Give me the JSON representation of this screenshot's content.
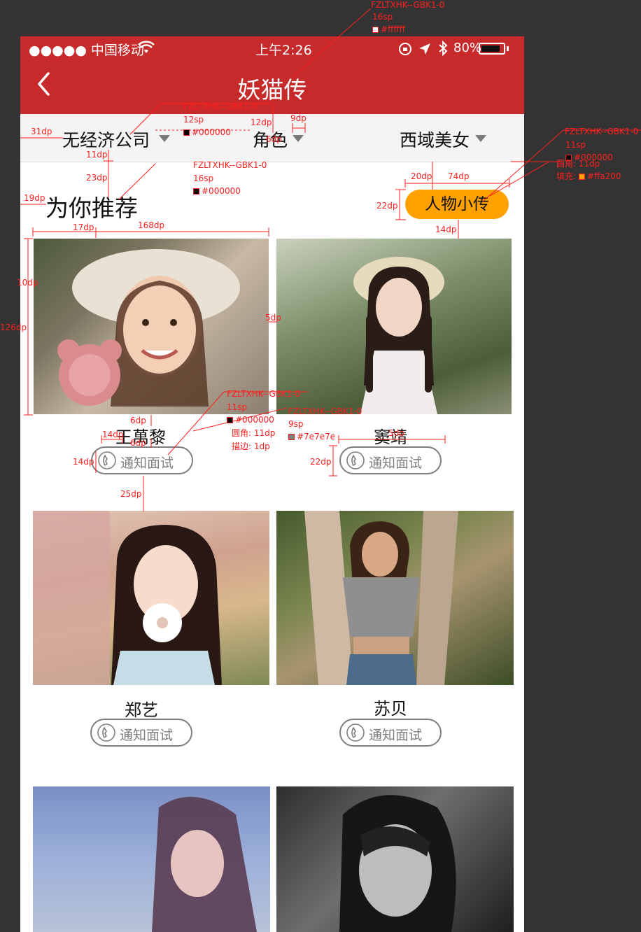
{
  "status_bar": {
    "carrier": "●●●●● 中国移动",
    "time": "上午2:26",
    "battery": "80%"
  },
  "nav": {
    "title": "妖猫传"
  },
  "filters": [
    {
      "label": "无经济公司"
    },
    {
      "label": "角色"
    },
    {
      "label": "西域美女"
    }
  ],
  "section": {
    "title": "为你推荐",
    "cta_label": "人物小传"
  },
  "cards": [
    {
      "name": "王萬黎",
      "button": "通知面试"
    },
    {
      "name": "窦靖",
      "button": "通知面试"
    },
    {
      "name": "郑艺",
      "button": "通知面试"
    },
    {
      "name": "苏贝",
      "button": "通知面试"
    }
  ],
  "annotations": {
    "title_spec": {
      "font": "FZLTXHK--GBK1-0",
      "size": "16sp",
      "color": "#ffffff"
    },
    "filter_spec": {
      "font": "FZLTXHK--GBK1-0",
      "size": "12sp",
      "color": "#000000"
    },
    "section_spec": {
      "font": "FZLTXHK--GBK1-0",
      "size": "16sp",
      "color": "#000000"
    },
    "cta_spec": {
      "font": "FZLTXHK--GBK1-0",
      "size": "11sp",
      "color": "#000000",
      "radius": "圆角: 11dp",
      "fill": "填充:",
      "fill_color": "#ffa200"
    },
    "name_spec": {
      "font": "FZLTXHK--GBK1-0",
      "size": "11sp",
      "color": "#000000",
      "radius": "圆角: 11dp",
      "stroke": "描边: 1dp"
    },
    "button_spec": {
      "font": "FZLTXHK--GBK1-0",
      "size": "9sp",
      "color": "#7e7e7e"
    },
    "dims": {
      "d31": "31dp",
      "d12a": "12dp",
      "d9": "9dp",
      "d6a": "6dp",
      "d11": "11dp",
      "d23": "23dp",
      "d19": "19dp",
      "d17": "17dp",
      "d168": "168dp",
      "d20": "20dp",
      "d74": "74dp",
      "d22a": "22dp",
      "d14a": "14dp",
      "d10": "10dp",
      "d126": "126dp",
      "d5": "5dp",
      "d6b": "6dp",
      "d14b": "14dp",
      "d6c": "6dp",
      "d14c": "14dp",
      "d25": "25dp",
      "d22b": "22dp",
      "d5b": "5dp"
    }
  }
}
